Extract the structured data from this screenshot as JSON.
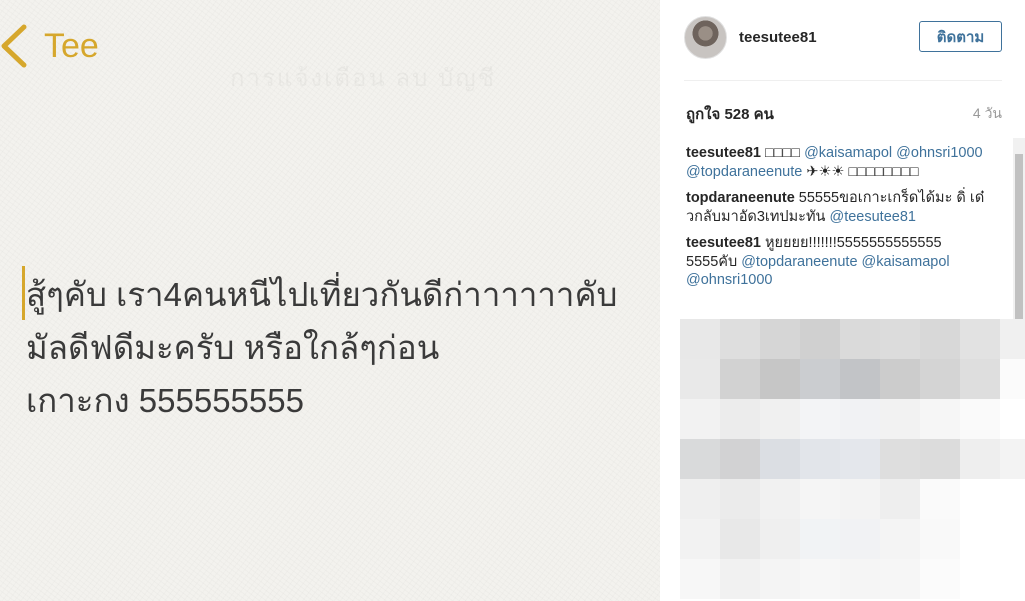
{
  "note": {
    "back_label": "Tee",
    "header_faint": "การแจ้งเตือน ลบ บัญชี",
    "lines": [
      "สู้ๆคับ เรา4คนหนีไปเที่ยวกันดีก่าาาาาาคับ",
      "มัลดีฟดีมะครับ หรือใกล้ๆก่อน",
      "เกาะกง 555555555"
    ],
    "accent_color": "#d6a72c"
  },
  "post": {
    "username": "teesutee81",
    "follow_label": "ติดตาม",
    "likes": "ถูกใจ 528 คน",
    "time": "4 วัน",
    "comments": [
      {
        "user": "teesutee81",
        "parts": [
          {
            "t": " □□□□ ",
            "m": false
          },
          {
            "t": "@kaisamapol",
            "m": true
          },
          {
            "t": " ",
            "m": false
          },
          {
            "t": "@ohnsri1000",
            "m": true
          },
          {
            "t": " ",
            "m": false
          },
          {
            "t": "@topdaraneenute",
            "m": true
          },
          {
            "t": " ✈☀☀ □□□□□□□□",
            "m": false
          }
        ]
      },
      {
        "user": "topdaraneenute",
        "parts": [
          {
            "t": " 55555ขอเกาะเกร็ดได้มะ ดิ่ เด๋วกลับมาอัด3เทปมะทัน ",
            "m": false
          },
          {
            "t": "@teesutee81",
            "m": true
          }
        ]
      },
      {
        "user": "teesutee81",
        "parts": [
          {
            "t": " หูยยยย!!!!!!!5555555555555 5555คับ ",
            "m": false
          },
          {
            "t": "@topdaraneenute",
            "m": true
          },
          {
            "t": " ",
            "m": false
          },
          {
            "t": "@kaisamapol",
            "m": true
          },
          {
            "t": " ",
            "m": false
          },
          {
            "t": "@ohnsri1000",
            "m": true
          }
        ]
      }
    ],
    "link_color": "#3f729b"
  },
  "pixel_colors": [
    [
      "#e8e8e8",
      "#dedede",
      "#d6d6d6",
      "#d0d0d0",
      "#dadada",
      "#dcdcdc",
      "#d8d8d8",
      "#e2e2e2",
      "#f0f0f0"
    ],
    [
      "#e9e9e9",
      "#d2d2d2",
      "#c6c6c6",
      "#cbcdd0",
      "#c2c4c7",
      "#cccccc",
      "#d4d4d4",
      "#dedede",
      "#fbfbfb"
    ],
    [
      "#f2f2f2",
      "#ececec",
      "#f0f0f0",
      "#f3f4f6",
      "#f1f2f4",
      "#f2f2f2",
      "#f6f6f6",
      "#fafafa",
      "#ffffff"
    ],
    [
      "#d9dadb",
      "#d2d2d3",
      "#dbdee3",
      "#e2e5ea",
      "#e4e7ec",
      "#dedede",
      "#dcdcdc",
      "#eeeeee",
      "#f3f3f3"
    ],
    [
      "#efefef",
      "#ebebeb",
      "#f1f1f1",
      "#f5f5f5",
      "#f3f3f3",
      "#eeeeee",
      "#fafafa",
      "#ffffff",
      "#ffffff"
    ],
    [
      "#f2f2f2",
      "#e8e8e8",
      "#efefef",
      "#f1f3f5",
      "#f1f2f4",
      "#f4f4f4",
      "#f9f9f9",
      "#ffffff",
      "#ffffff"
    ],
    [
      "#f7f7f7",
      "#f1f1f1",
      "#f4f4f4",
      "#f7f7f7",
      "#f5f5f5",
      "#f6f6f6",
      "#fbfbfb",
      "#ffffff",
      "#ffffff"
    ]
  ]
}
